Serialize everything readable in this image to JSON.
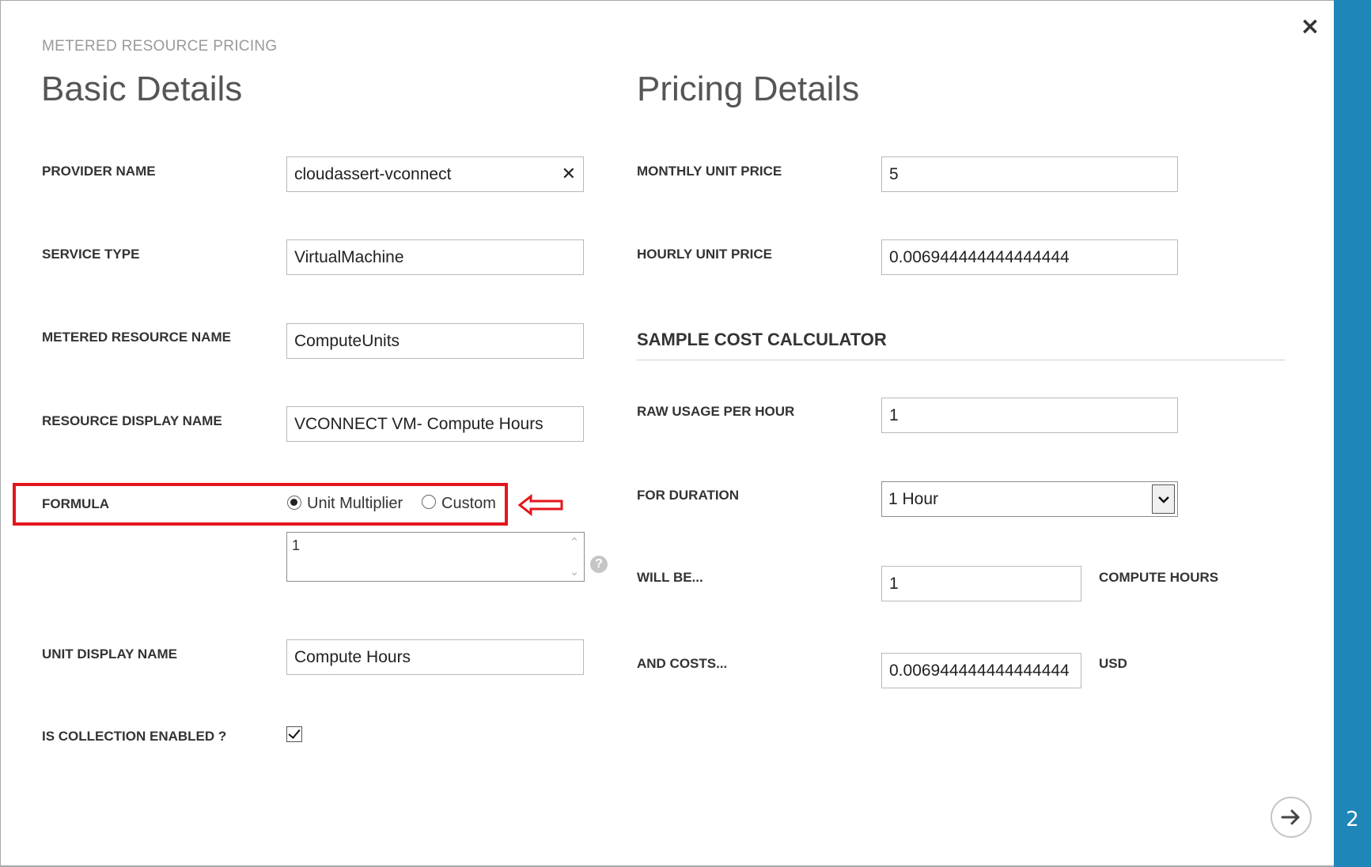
{
  "dialog": {
    "eyebrow": "METERED RESOURCE PRICING",
    "close_label": "×",
    "step_number": "2",
    "accent_color": "#1f86b8"
  },
  "basic_details": {
    "title": "Basic Details",
    "provider_name": {
      "label": "PROVIDER NAME",
      "value": "cloudassert-vconnect",
      "clear_glyph": "✕"
    },
    "service_type": {
      "label": "SERVICE TYPE",
      "value": "VirtualMachine"
    },
    "metered_resource_name": {
      "label": "METERED RESOURCE NAME",
      "value": "ComputeUnits"
    },
    "resource_display_name": {
      "label": "RESOURCE DISPLAY NAME",
      "value": "VCONNECT VM- Compute Hours"
    },
    "formula": {
      "label": "FORMULA",
      "options": [
        "Unit Multiplier",
        "Custom"
      ],
      "selected": "Unit Multiplier",
      "multiplier_value": "1",
      "help_glyph": "?"
    },
    "unit_display_name": {
      "label": "UNIT DISPLAY NAME",
      "value": "Compute Hours"
    },
    "collection_enabled": {
      "label": "IS COLLECTION ENABLED ?",
      "checked": true
    }
  },
  "pricing_details": {
    "title": "Pricing Details",
    "monthly_unit_price": {
      "label": "MONTHLY UNIT PRICE",
      "value": "5"
    },
    "hourly_unit_price": {
      "label": "HOURLY UNIT PRICE",
      "value": "0.006944444444444444"
    },
    "calculator": {
      "heading": "SAMPLE COST CALCULATOR",
      "raw_usage": {
        "label": "RAW USAGE PER HOUR",
        "value": "1"
      },
      "duration": {
        "label": "FOR DURATION",
        "value": "1 Hour"
      },
      "will_be": {
        "label": "WILL BE...",
        "value": "1",
        "unit": "COMPUTE HOURS"
      },
      "costs": {
        "label": "AND COSTS...",
        "value": "0.006944444444444444",
        "unit": "USD"
      }
    }
  },
  "annotation": {
    "highlight_color": "#e3161c"
  }
}
